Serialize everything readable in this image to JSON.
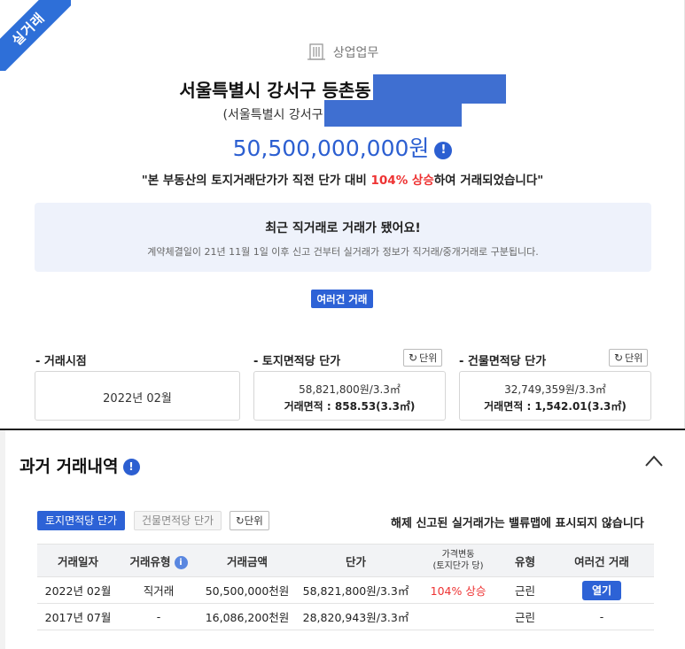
{
  "ribbon": "실거래",
  "category": {
    "label": "상업업무",
    "icon": "building-icon"
  },
  "address": {
    "main": "서울특별시 강서구 등촌동",
    "sub": "(서울특별시 강서구"
  },
  "price": {
    "value": "50,500,000,000원",
    "info_icon": "info-icon"
  },
  "quote": {
    "prefix": "\"본 부동산의 토지거래단가가 직전 단가 대비 ",
    "highlight": "104% 상승",
    "suffix": "하여 거래되었습니다\""
  },
  "notice": {
    "title": "최근 직거래로 거래가 됐어요!",
    "subtitle": "계약체결일이 21년 11월 1일 이후 신고 건부터 실거래가 정보가 직거래/중개거래로 구분됩니다."
  },
  "multi_button": "여러건 거래",
  "summary": {
    "date": {
      "label": "- 거래시점",
      "value": "2022년 02월"
    },
    "land": {
      "label": "- 토지면적당 단가",
      "unit_button": "단위",
      "price": "58,821,800원/3.3㎡",
      "area": "거래면적 : 858.53(3.3㎡)"
    },
    "building": {
      "label": "- 건물면적당 단가",
      "unit_button": "단위",
      "price": "32,749,359원/3.3㎡",
      "area": "거래면적 : 1,542.01(3.3㎡)"
    }
  },
  "history": {
    "title": "과거 거래내역",
    "tabs": [
      "토지면적당 단가",
      "건물면적당 단가"
    ],
    "unit_button": "단위",
    "note": "해제 신고된 실거래가는 밸류맵에 표시되지 않습니다",
    "headers": {
      "date": "거래일자",
      "type": "거래유형",
      "amount": "거래금액",
      "unit": "단가",
      "change1": "가격변동",
      "change2": "(토지단가 당)",
      "kind": "유형",
      "multi": "여러건 거래"
    },
    "rows": [
      {
        "date": "2022년 02월",
        "type": "직거래",
        "amount": "50,500,000천원",
        "unit": "58,821,800원/3.3㎡",
        "change": "104% 상승",
        "kind": "근린",
        "multi": "열기"
      },
      {
        "date": "2017년 07월",
        "type": "-",
        "amount": "16,086,200천원",
        "unit": "28,820,943원/3.3㎡",
        "change": "",
        "kind": "근린",
        "multi": "-"
      }
    ]
  },
  "colors": {
    "accent": "#2d62d6",
    "up": "#e33333",
    "mask": "#3f6fd1"
  }
}
